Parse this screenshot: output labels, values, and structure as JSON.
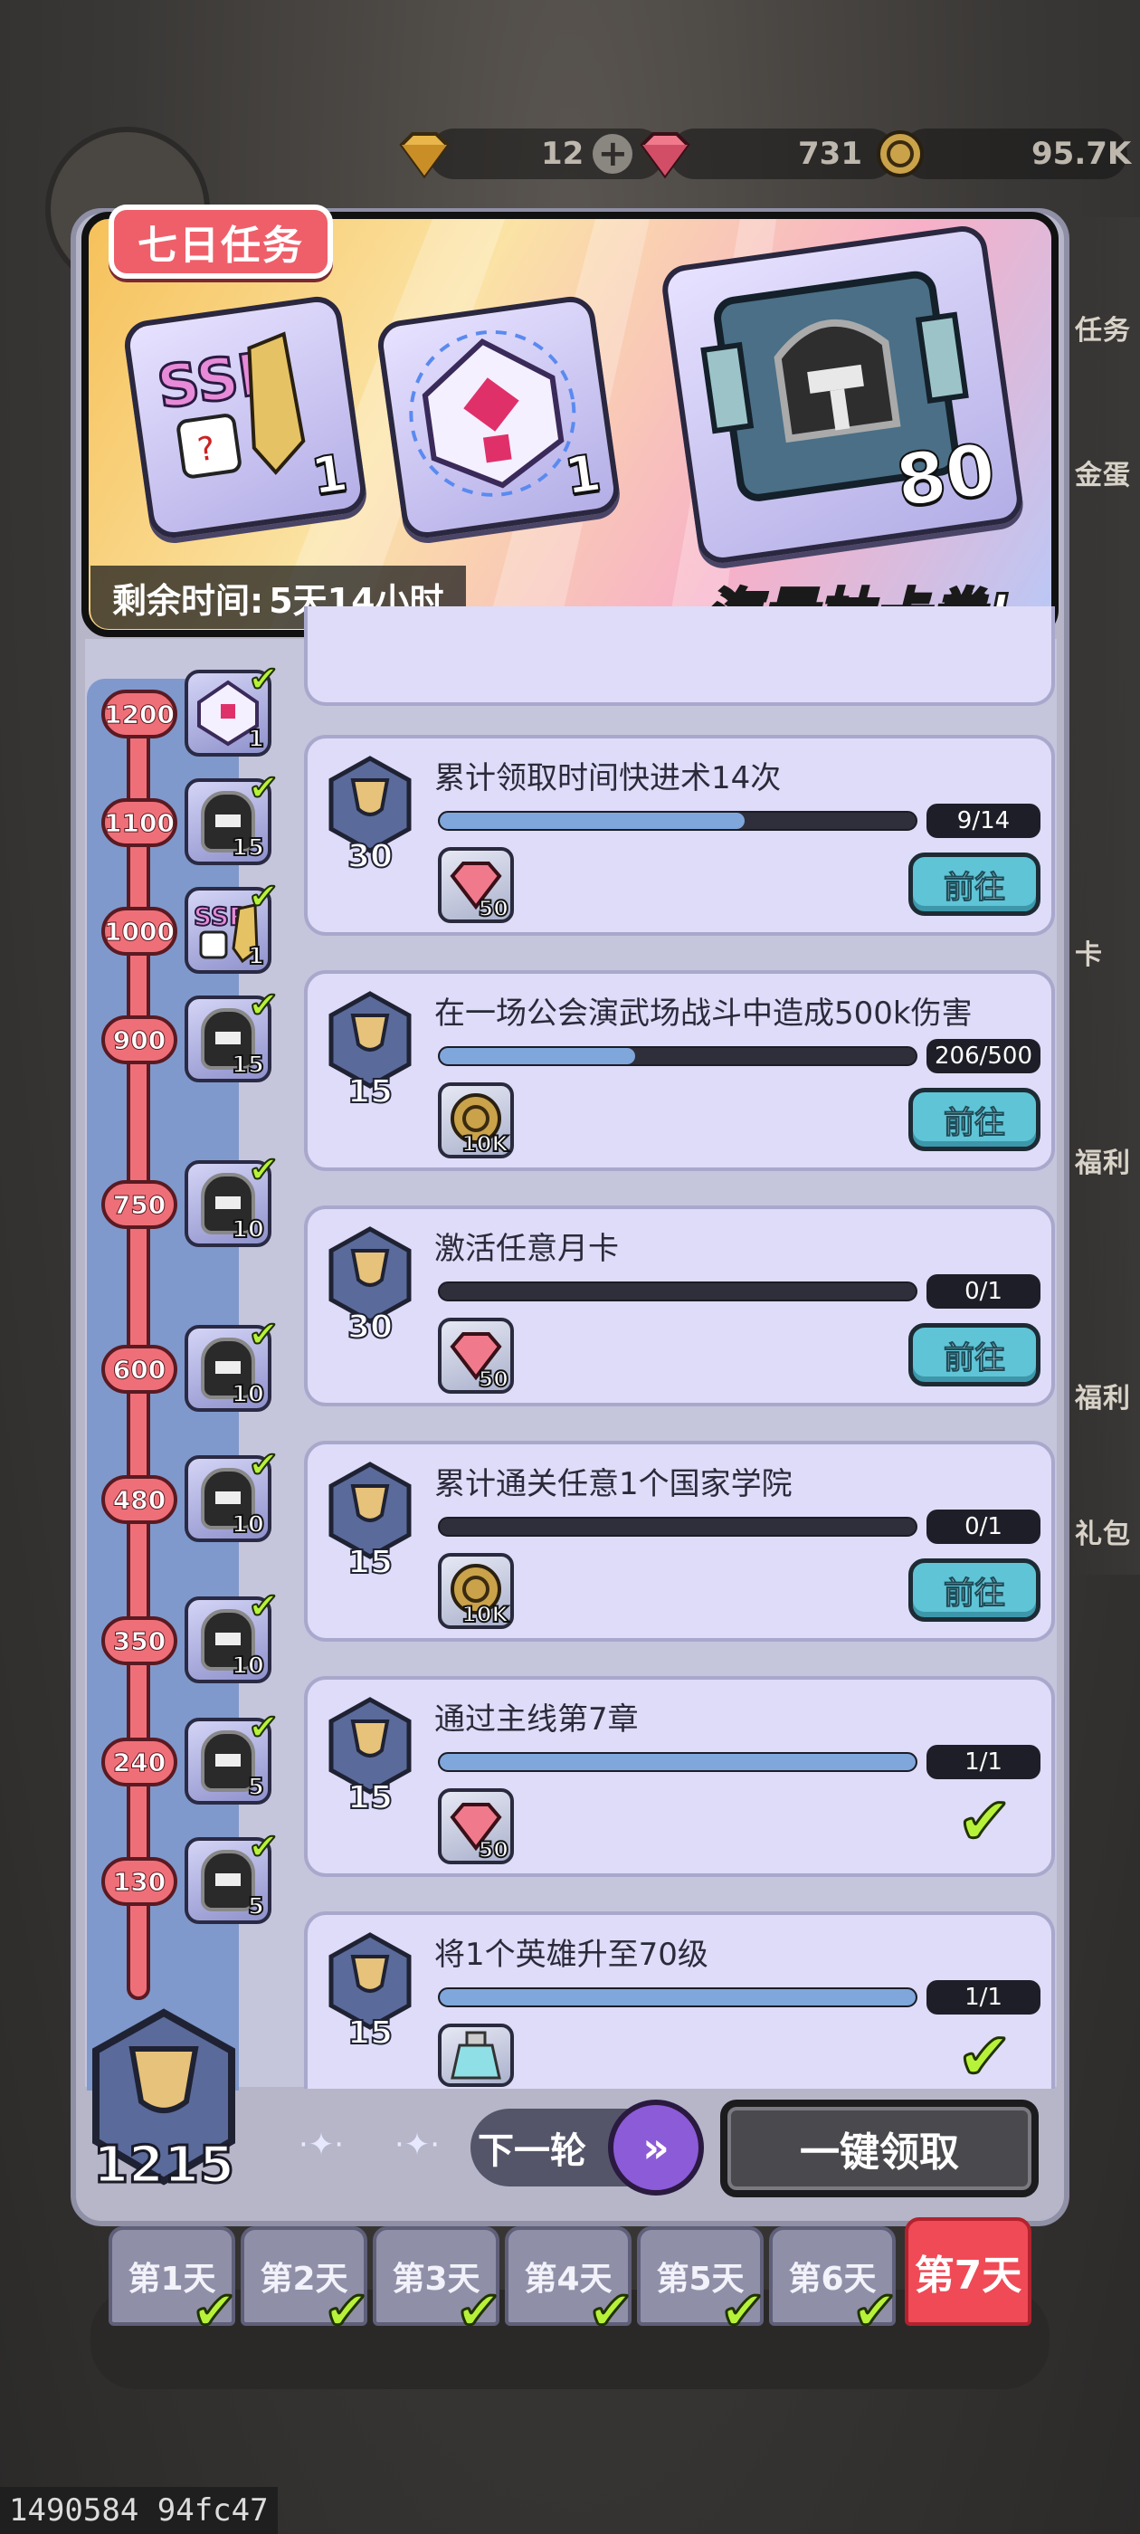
{
  "currencies": [
    {
      "name": "gold-gem",
      "value": "12",
      "has_plus": true
    },
    {
      "name": "red-gem",
      "value": "731",
      "has_plus": false
    },
    {
      "name": "coin",
      "value": "95.7K",
      "has_plus": false
    }
  ],
  "banner": {
    "tag": "七日任务",
    "remaining_label": "剩余时间:",
    "remaining_value": "5天14小时",
    "slogan": "海量抽卡券!",
    "rewards": [
      {
        "icon": "ssr-ticket-icon",
        "count": "1"
      },
      {
        "icon": "rune-stone-icon",
        "count": "1"
      },
      {
        "icon": "helmet-book-icon",
        "count": "80"
      }
    ]
  },
  "milestones": [
    {
      "value": "1200",
      "reward": "rune-stone-icon",
      "count": "1"
    },
    {
      "value": "1100",
      "reward": "helmet-book-icon",
      "count": "15"
    },
    {
      "value": "1000",
      "reward": "ssr-ticket-icon",
      "count": "1"
    },
    {
      "value": "900",
      "reward": "helmet-book-icon",
      "count": "15"
    },
    {
      "value": "750",
      "reward": "helmet-book-icon",
      "count": "10"
    },
    {
      "value": "600",
      "reward": "helmet-book-icon",
      "count": "10"
    },
    {
      "value": "480",
      "reward": "helmet-book-icon",
      "count": "10"
    },
    {
      "value": "350",
      "reward": "helmet-book-icon",
      "count": "10"
    },
    {
      "value": "240",
      "reward": "helmet-book-icon",
      "count": "5"
    },
    {
      "value": "130",
      "reward": "helmet-book-icon",
      "count": "5"
    }
  ],
  "tasks": [
    {
      "title": "累计领取时间快进术14次",
      "points": "30",
      "progress_text": "9/14",
      "progress": 0.64,
      "reward_icon": "red-gem-icon",
      "reward_count": "50",
      "action": "前往",
      "done": false
    },
    {
      "title": "在一场公会演武场战斗中造成500k伤害",
      "points": "15",
      "progress_text": "206/500",
      "progress": 0.41,
      "reward_icon": "coin-icon",
      "reward_count": "10K",
      "action": "前往",
      "done": false
    },
    {
      "title": "激活任意月卡",
      "points": "30",
      "progress_text": "0/1",
      "progress": 0,
      "reward_icon": "red-gem-icon",
      "reward_count": "50",
      "action": "前往",
      "done": false
    },
    {
      "title": "累计通关任意1个国家学院",
      "points": "15",
      "progress_text": "0/1",
      "progress": 0,
      "reward_icon": "coin-icon",
      "reward_count": "10K",
      "action": "前往",
      "done": false
    },
    {
      "title": "通过主线第7章",
      "points": "15",
      "progress_text": "1/1",
      "progress": 1,
      "reward_icon": "red-gem-icon",
      "reward_count": "50",
      "action": "",
      "done": true
    },
    {
      "title": "将1个英雄升至70级",
      "points": "15",
      "progress_text": "1/1",
      "progress": 1,
      "reward_icon": "potion-icon",
      "reward_count": "",
      "action": "",
      "done": true
    }
  ],
  "total_points": "1215",
  "next_round_label": "下一轮",
  "claim_all_label": "一键领取",
  "days": [
    {
      "label": "第1天",
      "done": true,
      "active": false
    },
    {
      "label": "第2天",
      "done": true,
      "active": false
    },
    {
      "label": "第3天",
      "done": true,
      "active": false
    },
    {
      "label": "第4天",
      "done": true,
      "active": false
    },
    {
      "label": "第5天",
      "done": true,
      "active": false
    },
    {
      "label": "第6天",
      "done": true,
      "active": false
    },
    {
      "label": "第7天",
      "done": false,
      "active": true
    }
  ],
  "side_labels": [
    "任务",
    "金蛋",
    "卡",
    "福利",
    "福利",
    "礼包"
  ],
  "footer_id": "1490584 94fc47",
  "colors": {
    "accent_red": "#ef4a55",
    "go_button": "#5fc4d6",
    "check": "#b7f23a",
    "panel": "#b6b6c8"
  }
}
